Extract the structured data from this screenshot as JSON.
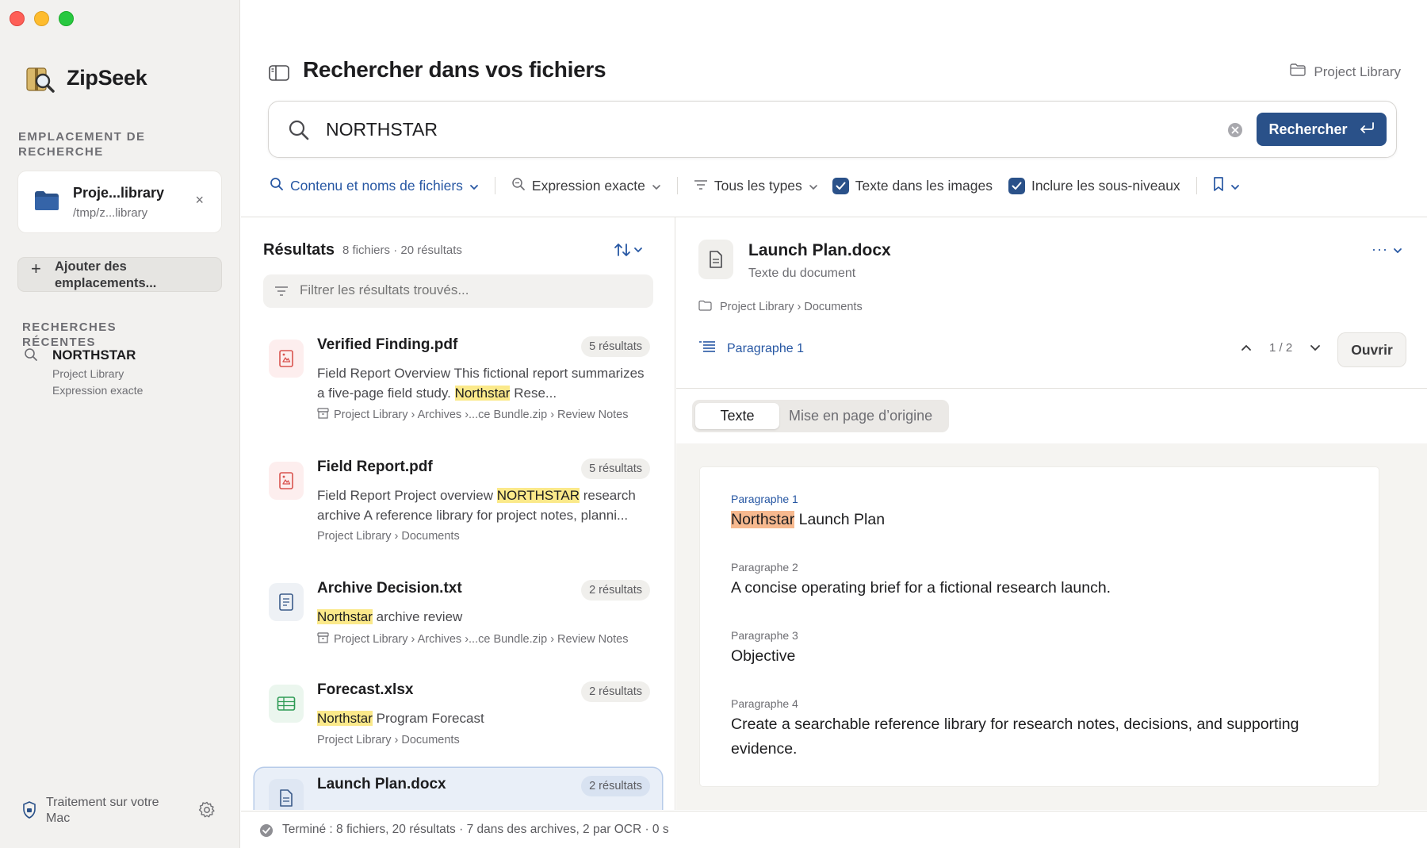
{
  "app": {
    "name": "ZipSeek"
  },
  "sidebar": {
    "location_section": "EMPLACEMENT DE RECHERCHE",
    "location": {
      "name": "Proje...library",
      "path": "/tmp/z...library",
      "remove_label": "×"
    },
    "add_button": {
      "label": "Ajouter des emplacements..."
    },
    "recent_section": "RECHERCHES RÉCENTES",
    "recent": [
      {
        "query": "NORTHSTAR",
        "scope": "Project Library",
        "mode": "Expression exacte"
      }
    ],
    "footer": {
      "processing": "Traitement sur votre Mac"
    }
  },
  "header": {
    "title": "Rechercher dans vos fichiers",
    "library_link": "Project Library"
  },
  "search": {
    "value": "NORTHSTAR",
    "button_label": "Rechercher"
  },
  "filters": {
    "scope": "Contenu et noms de fichiers",
    "match": "Expression exacte",
    "types": "Tous les types",
    "ocr": {
      "label": "Texte dans les images",
      "checked": true
    },
    "subfolders": {
      "label": "Inclure les sous-niveaux",
      "checked": true
    }
  },
  "results": {
    "title": "Résultats",
    "count": "8 fichiers · 20 résultats",
    "filter_placeholder": "Filtrer les résultats trouvés...",
    "items": [
      {
        "name": "Verified Finding.pdf",
        "badge": "5 résultats",
        "snippet_pre": "Field Report Overview This fictional report summarizes a five-page field study. ",
        "snippet_hl": "Northstar",
        "snippet_post": " Rese...",
        "path": "Project Library › Archives ›...ce Bundle.zip › Review Notes"
      },
      {
        "name": "Field Report.pdf",
        "badge": "5 résultats",
        "snippet_pre": "Field Report Project overview ",
        "snippet_hl": "NORTHSTAR",
        "snippet_post": " research archive A reference library for project notes, planni...",
        "path": "Project Library › Documents"
      },
      {
        "name": "Archive Decision.txt",
        "badge": "2 résultats",
        "snippet_pre": "",
        "snippet_hl": "Northstar",
        "snippet_post": " archive review",
        "path": "Project Library › Archives ›...ce Bundle.zip › Review Notes"
      },
      {
        "name": "Forecast.xlsx",
        "badge": "2 résultats",
        "snippet_pre": "",
        "snippet_hl": "Northstar",
        "snippet_post": " Program Forecast",
        "path": "Project Library › Documents"
      },
      {
        "name": "Launch Plan.docx",
        "badge": "2 résultats"
      }
    ]
  },
  "preview": {
    "file_name": "Launch Plan.docx",
    "subtitle": "Texte du document",
    "path": "Project Library › Documents",
    "current_paragraph": "Paragraphe 1",
    "nav_counter": "1 / 2",
    "open_button": "Ouvrir",
    "more_label": "···",
    "tabs": [
      "Texte",
      "Mise en page d’origine"
    ],
    "paragraphs": [
      {
        "label": "Paragraphe 1",
        "hl": "Northstar",
        "text": " Launch Plan"
      },
      {
        "label": "Paragraphe 2",
        "text": "A concise operating brief for a fictional research launch."
      },
      {
        "label": "Paragraphe 3",
        "text": "Objective"
      },
      {
        "label": "Paragraphe 4",
        "text": "Create a searchable reference library for research notes, decisions, and supporting evidence."
      }
    ]
  },
  "status": {
    "text": "Terminé : 8 fichiers, 20 résultats · 7 dans des archives, 2 par OCR · 0 s"
  },
  "colors": {
    "accent": "#2a5189",
    "highlight": "#fbe98a",
    "active_highlight": "#f7b98f",
    "sidebar_bg": "#f2f1ef"
  }
}
